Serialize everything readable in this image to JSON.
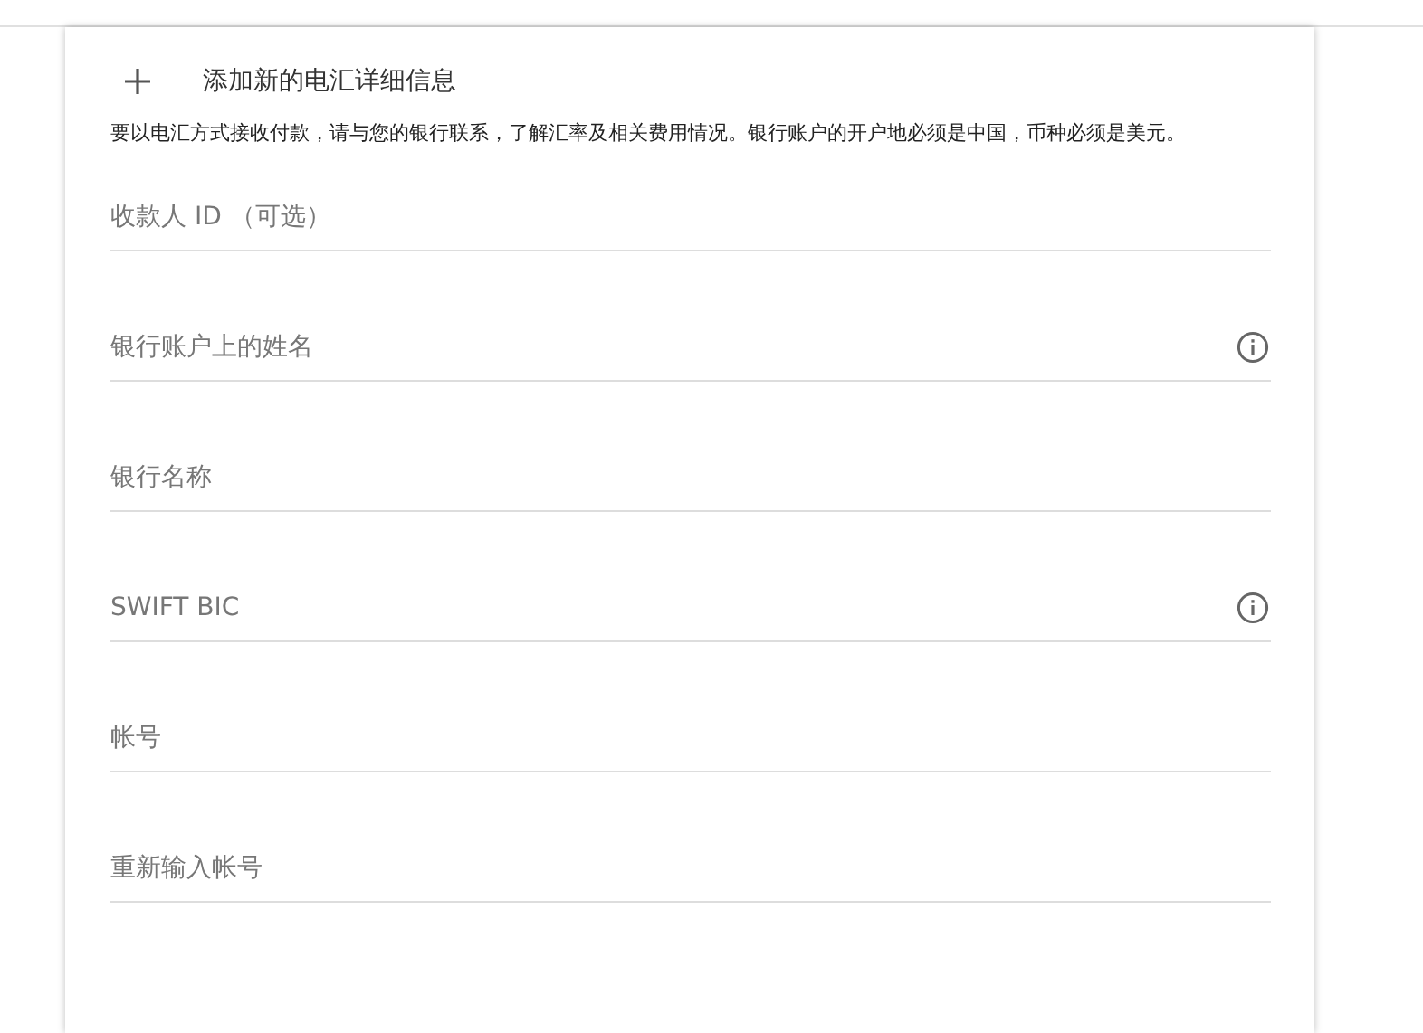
{
  "header": {
    "title": "添加新的电汇详细信息"
  },
  "description": "要以电汇方式接收付款，请与您的银行联系，了解汇率及相关费用情况。银行账户的开户地必须是中国，币种必须是美元。",
  "fields": [
    {
      "placeholder": "收款人 ID （可选）",
      "info": false
    },
    {
      "placeholder": "银行账户上的姓名",
      "info": true
    },
    {
      "placeholder": "银行名称",
      "info": false
    },
    {
      "placeholder": "SWIFT BIC",
      "info": true
    },
    {
      "placeholder": "帐号",
      "info": false
    },
    {
      "placeholder": "重新输入帐号",
      "info": false
    }
  ]
}
